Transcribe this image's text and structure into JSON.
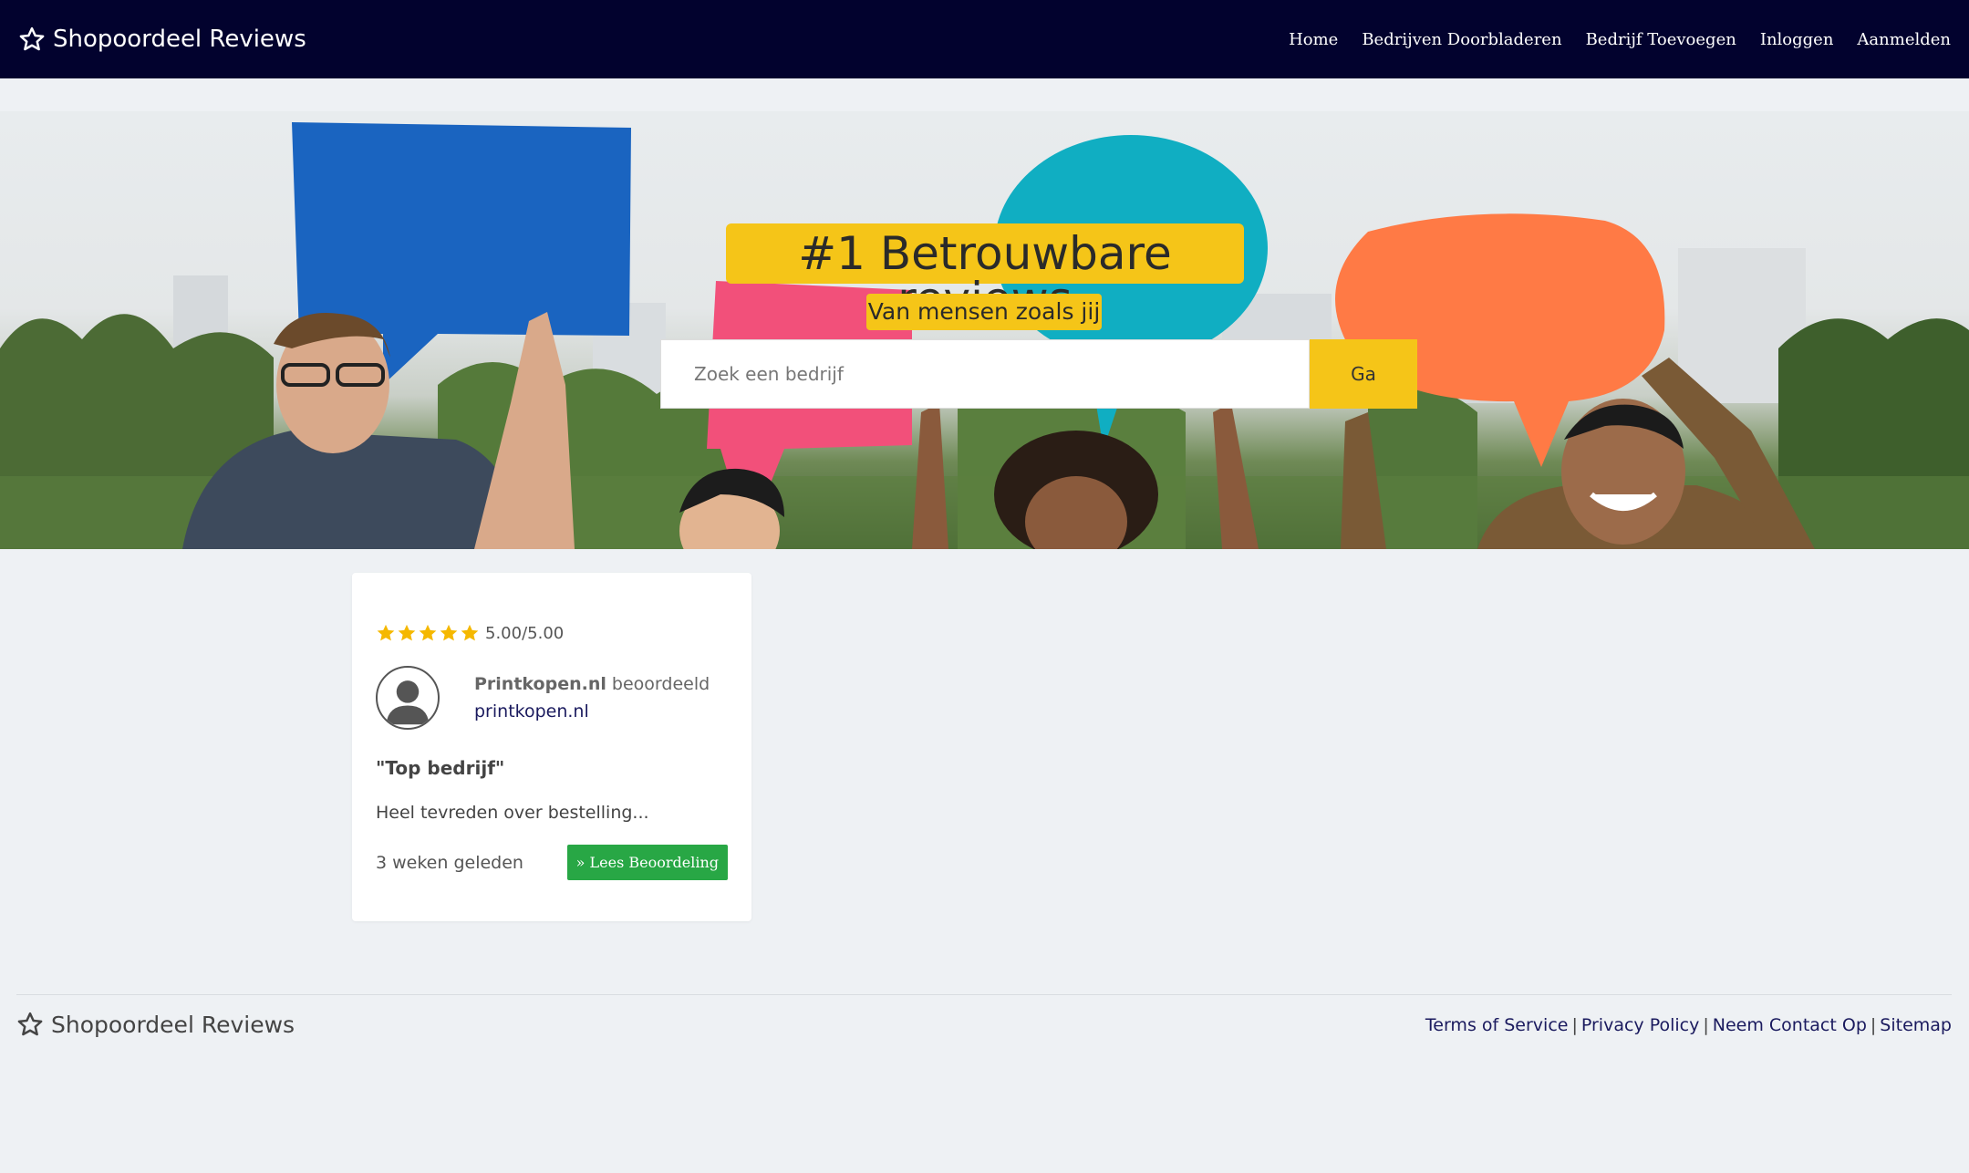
{
  "nav": {
    "brand": "Shopoordeel Reviews",
    "links": [
      "Home",
      "Bedrijven Doorbladeren",
      "Bedrijf Toevoegen",
      "Inloggen",
      "Aanmelden"
    ]
  },
  "hero": {
    "title": "#1 Betrouwbare reviews",
    "subtitle": "Van mensen zoals jij",
    "search_placeholder": "Zoek een bedrijf",
    "search_button": "Ga"
  },
  "review": {
    "stars": 5,
    "rating": "5.00/5.00",
    "author": "Printkopen.nl",
    "reviewed_word": "beoordeeld",
    "company": "printkopen.nl",
    "title": "\"Top bedrijf\"",
    "body": "Heel tevreden over bestelling...",
    "time_ago": "3 weken geleden",
    "read_button": "» Lees Beoordeling"
  },
  "footer": {
    "brand": "Shopoordeel Reviews",
    "links": [
      "Terms of Service",
      "Privacy Policy",
      "Neem Contact Op",
      "Sitemap"
    ],
    "separator": "|"
  },
  "colors": {
    "navbar": "#02022e",
    "accent": "#f5c518",
    "button_green": "#28a745",
    "background": "#eef1f4"
  }
}
